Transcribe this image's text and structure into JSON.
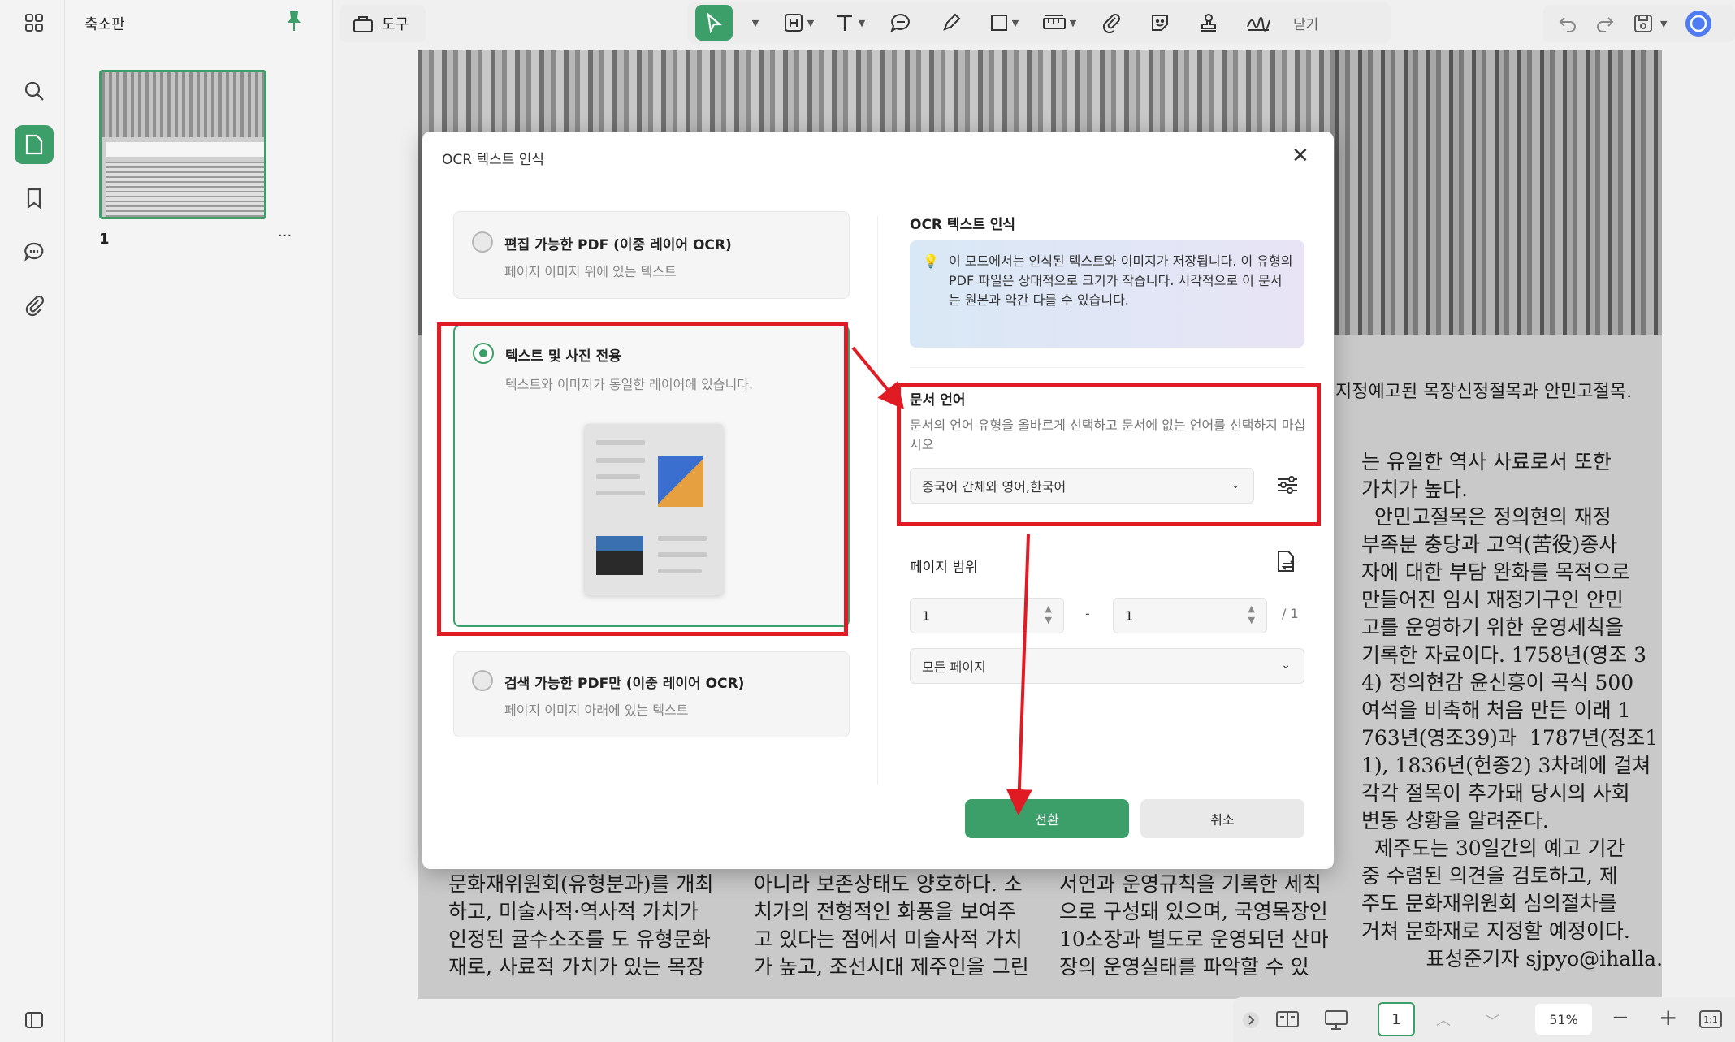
{
  "thumbnail_panel": {
    "title": "축소판",
    "page_number": "1",
    "more_label": "···"
  },
  "toolbar": {
    "tools_label": "도구",
    "close_label": "닫기",
    "accent": "#3c9e68"
  },
  "document": {
    "caption": "지정예고된 목장신정절목과 안민고절목.",
    "right_column": [
      "는 유일한 역사 사료로서 또한",
      "가치가 높다.",
      "  안민고절목은 정의현의 재정",
      "부족분 충당과 고역(苦役)종사",
      "자에 대한 부담 완화를 목적으로",
      "만들어진 임시 재정기구인 안민",
      "고를 운영하기 위한 운영세칙을",
      "기록한 자료이다. 1758년(영조 3",
      "4) 정의현감 윤신흥이 곡식 500",
      "여석을 비축해 처음 만든 이래 1",
      "763년(영조39)과  1787년(정조1",
      "1), 1836년(헌종2) 3차례에 걸쳐",
      "각각 절목이 추가돼 당시의 사회",
      "변동 상황을 알려준다.",
      "  제주도는 30일간의 예고 기간",
      "중 수렴된 의견을 검토하고, 제",
      "주도 문화재위원회 심의절차를",
      "거쳐 문화재로 지정할 예정이다.",
      "          표성준기자 sjpyo@ihalla.com"
    ],
    "bottom_col1": [
      "문화재위원회(유형분과)를 개최",
      "하고, 미술사적·역사적 가치가",
      "인정된 귤수소조를 도 유형문화",
      "재로, 사료적 가치가 있는 목장"
    ],
    "bottom_col2": [
      "아니라 보존상태도 양호하다. 소",
      "치가의 전형적인 화풍을 보여주",
      "고 있다는 점에서 미술사적 가치",
      "가 높고, 조선시대 제주인을 그린"
    ],
    "bottom_col3": [
      "서언과 운영규칙을 기록한 세칙",
      "으로 구성돼 있으며, 국영목장인",
      "10소장과 별도로 운영되던 산마",
      "장의 운영실태를 파악할 수 있"
    ]
  },
  "dialog": {
    "title": "OCR 텍스트 인식",
    "options": [
      {
        "label": "편집 가능한 PDF (이중 레이어 OCR)",
        "desc": "페이지 이미지 위에 있는 텍스트",
        "selected": false
      },
      {
        "label": "텍스트 및 사진 전용",
        "desc": "텍스트와 이미지가 동일한 레이어에 있습니다.",
        "selected": true
      },
      {
        "label": "검색 가능한 PDF만 (이중 레이어 OCR)",
        "desc": "페이지 이미지 아래에 있는 텍스트",
        "selected": false
      }
    ],
    "ocr_section_title": "OCR 텍스트 인식",
    "info_text": "이 모드에서는 인식된 텍스트와 이미지가 저장됩니다. 이 유형의 PDF 파일은 상대적으로 크기가 작습니다. 시각적으로 이 문서는 원본과 약간 다를 수 있습니다.",
    "language_title": "문서 언어",
    "language_desc": "문서의 언어 유형을 올바르게 선택하고 문서에 없는 언어를 선택하지 마십시오",
    "language_value": "중국어 간체와 영어,한국어",
    "page_range_title": "페이지 범위",
    "page_from": "1",
    "page_to": "1",
    "range_dash": "-",
    "page_total": "/ 1",
    "page_mode": "모든 페이지",
    "convert_label": "전환",
    "cancel_label": "취소"
  },
  "bottom_bar": {
    "current_page": "1",
    "zoom": "51%",
    "fit_label": "1:1"
  },
  "colors": {
    "highlight": "#e01b24",
    "accent": "#3c9e68"
  }
}
